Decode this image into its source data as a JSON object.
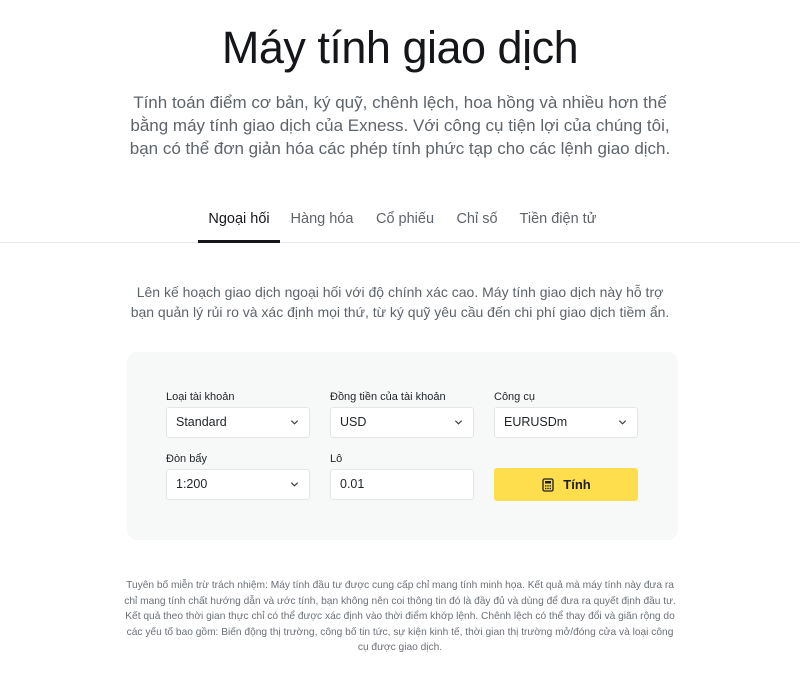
{
  "header": {
    "title": "Máy tính giao dịch",
    "subtitle": "Tính toán điểm cơ bản, ký quỹ, chênh lệch, hoa hồng và nhiều hơn thế bằng máy tính giao dịch của Exness. Với công cụ tiện lợi của chúng tôi, bạn có thể đơn giản hóa các phép tính phức tạp cho các lệnh giao dịch."
  },
  "tabs": [
    {
      "label": "Ngoại hối",
      "active": true
    },
    {
      "label": "Hàng hóa",
      "active": false
    },
    {
      "label": "Cổ phiếu",
      "active": false
    },
    {
      "label": "Chỉ số",
      "active": false
    },
    {
      "label": "Tiền điện tử",
      "active": false
    }
  ],
  "intro": "Lên kế hoạch giao dịch ngoại hối với độ chính xác cao. Máy tính giao dịch này hỗ trợ bạn quản lý rủi ro và xác định mọi thứ, từ ký quỹ yêu cầu đến chi phí giao dịch tiềm ẩn.",
  "form": {
    "account_type": {
      "label": "Loại tài khoản",
      "value": "Standard"
    },
    "account_currency": {
      "label": "Đồng tiền của tài khoản",
      "value": "USD"
    },
    "instrument": {
      "label": "Công cụ",
      "value": "EURUSDm"
    },
    "leverage": {
      "label": "Đòn bẩy",
      "value": "1:200"
    },
    "lot": {
      "label": "Lô",
      "value": "0.01"
    },
    "calculate_label": "Tính"
  },
  "disclaimer": "Tuyên bố miễn trừ trách nhiệm: Máy tính đầu tư được cung cấp chỉ mang tính minh họa. Kết quả mà máy tính này đưa ra chỉ mang tính chất hướng dẫn và ước tính, bạn không nên coi thông tin đó là đầy đủ và dùng để đưa ra quyết định đầu tư. Kết quả theo thời gian thực chỉ có thể được xác định vào thời điểm khớp lệnh. Chênh lệch có thể thay đổi và giãn rộng do các yếu tố bao gồm: Biến động thị trường, công bố tin tức, sự kiện kinh tế, thời gian thị trường mở/đóng cửa và loại công cụ được giao dịch.",
  "colors": {
    "accent_button": "#ffde4d",
    "panel_bg": "#f7f8f8"
  },
  "icons": {
    "select_arrow": "chevron-down-icon",
    "calculate": "calculator-icon"
  }
}
